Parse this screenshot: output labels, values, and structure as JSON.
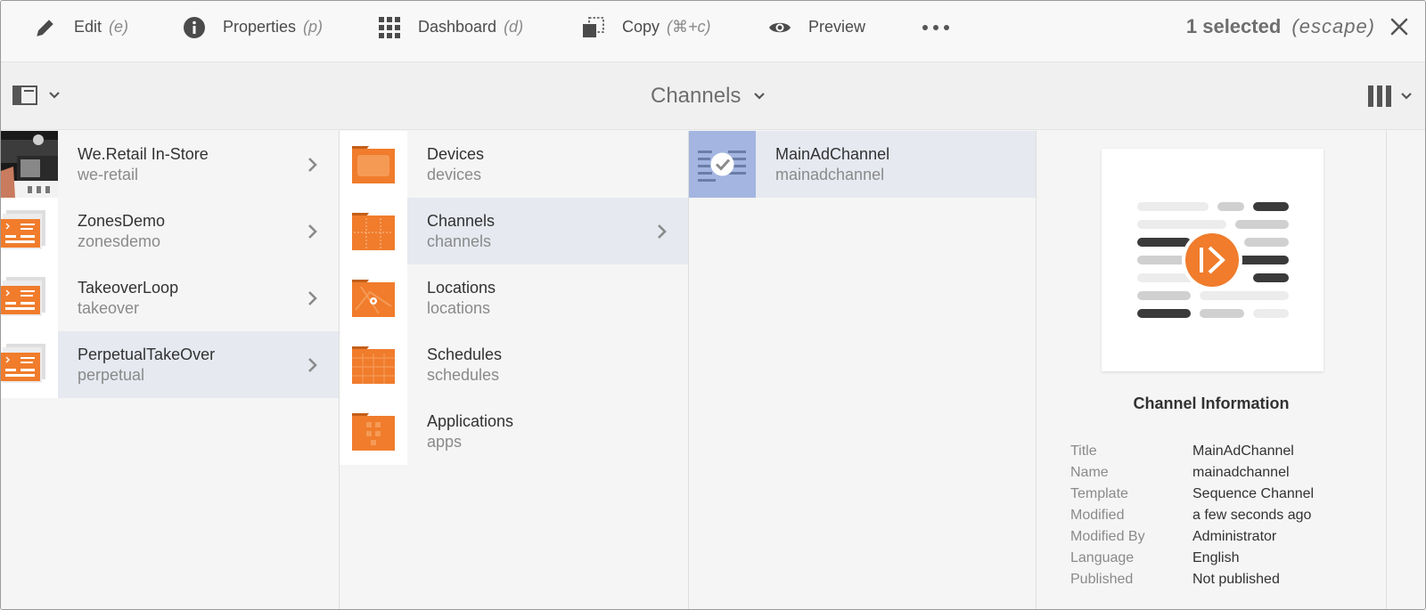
{
  "actionbar": {
    "edit": {
      "label": "Edit",
      "shortcut": "(e)"
    },
    "properties": {
      "label": "Properties",
      "shortcut": "(p)"
    },
    "dashboard": {
      "label": "Dashboard",
      "shortcut": "(d)"
    },
    "copy": {
      "label": "Copy",
      "shortcut": "(⌘+c)"
    },
    "preview": {
      "label": "Preview"
    },
    "more_icon": "more-dots-icon",
    "selection": {
      "count": "1 selected",
      "escape": "(escape)"
    },
    "close_icon": "close-icon"
  },
  "header": {
    "title": "Channels",
    "rail_icon": "rail-toggle-icon",
    "view_icon": "column-view-icon"
  },
  "column1": {
    "items": [
      {
        "title": "We.Retail In-Store",
        "sub": "we-retail"
      },
      {
        "title": "ZonesDemo",
        "sub": "zonesdemo"
      },
      {
        "title": "TakeoverLoop",
        "sub": "takeover"
      },
      {
        "title": "PerpetualTakeOver",
        "sub": "perpetual"
      }
    ]
  },
  "column2": {
    "items": [
      {
        "title": "Devices",
        "sub": "devices"
      },
      {
        "title": "Channels",
        "sub": "channels"
      },
      {
        "title": "Locations",
        "sub": "locations"
      },
      {
        "title": "Schedules",
        "sub": "schedules"
      },
      {
        "title": "Applications",
        "sub": "apps"
      }
    ]
  },
  "column3": {
    "items": [
      {
        "title": "MainAdChannel",
        "sub": "mainadchannel"
      }
    ]
  },
  "preview": {
    "heading": "Channel Information",
    "fields": [
      {
        "key": "Title",
        "value": "MainAdChannel"
      },
      {
        "key": "Name",
        "value": "mainadchannel"
      },
      {
        "key": "Template",
        "value": "Sequence Channel"
      },
      {
        "key": "Modified",
        "value": "a few seconds ago"
      },
      {
        "key": "Modified By",
        "value": "Administrator"
      },
      {
        "key": "Language",
        "value": "English"
      },
      {
        "key": "Published",
        "value": "Not published"
      }
    ]
  },
  "colors": {
    "accent_orange": "#f07c2c",
    "selection_bg": "#e6e9f0",
    "selected_thumb": "#a3b5e0"
  }
}
